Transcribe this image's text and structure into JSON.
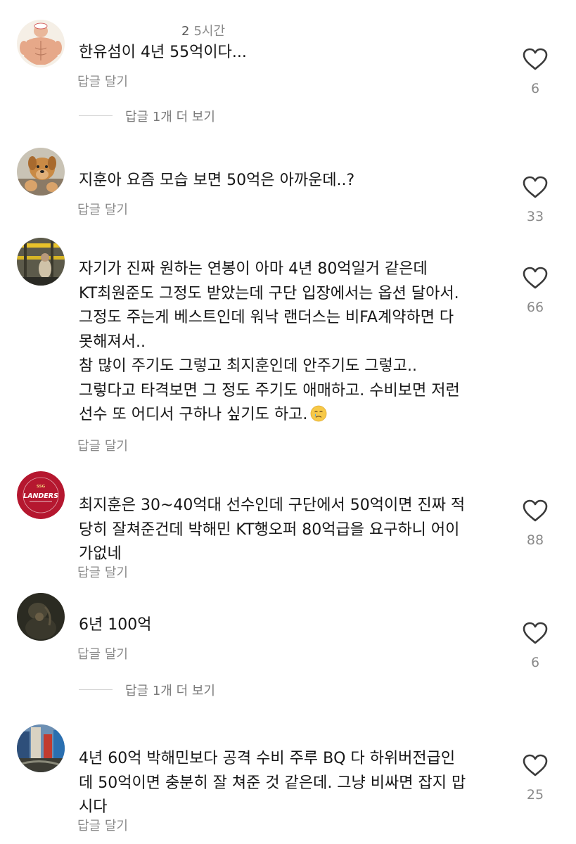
{
  "comments": [
    {
      "username": "2",
      "time": "5시간",
      "text": "한유섬이 4년 55억이다...",
      "reply_label": "답글 달기",
      "likes": "6",
      "more_replies": "답글 1개 더 보기"
    },
    {
      "username": "",
      "time": "",
      "text": "지훈아 요즘 모습 보면 50억은 아까운데..?",
      "reply_label": "답글 달기",
      "likes": "33"
    },
    {
      "username": "",
      "time": "",
      "text": "자기가 진짜 원하는 연봉이 아마 4년 80억일거 같은데\nKT최원준도 그정도 받았는데 구단 입장에서는 옵션 달아서.\n그정도 주는게 베스트인데 워낙 랜더스는 비FA계약하면 다\n못해져서..\n참 많이 주기도 그렇고 최지훈인데 안주기도 그렇고..\n그렇다고 타격보면 그 정도 주기도 애매하고. 수비보면 저런\n선수 또 어디서 구하나 싶기도 하고.",
      "emoji": "crying-face",
      "reply_label": "답글 달기",
      "likes": "66"
    },
    {
      "username": "",
      "time": "",
      "avatar_text": "LANDERS",
      "avatar_small": "SSG",
      "text": "최지훈은 30~40억대 선수인데 구단에서 50억이면 진짜 적\n당히 잘쳐준건데 박해민 KT행오퍼 80억급을 요구하니 어이\n가없네",
      "reply_label": "답글 달기",
      "likes": "88"
    },
    {
      "username": "",
      "time": "",
      "text": "6년 100억",
      "reply_label": "답글 달기",
      "likes": "6",
      "more_replies": "답글 1개 더 보기"
    },
    {
      "username": "",
      "time": "",
      "text": "4년 60억 박해민보다 공격 수비 주루 BQ  다 하위버전급인\n데 50억이면 충분히 잘 쳐준 것 같은데. 그냥 비싸면 잡지 맙\n시다",
      "reply_label": "답글 달기",
      "likes": "25"
    }
  ],
  "colors": {
    "text": "#161616",
    "secondary": "#8a8a8a",
    "divider": "#d4d4d4",
    "landers_red": "#b5172f"
  },
  "icons": {
    "like": "heart-outline-icon"
  }
}
